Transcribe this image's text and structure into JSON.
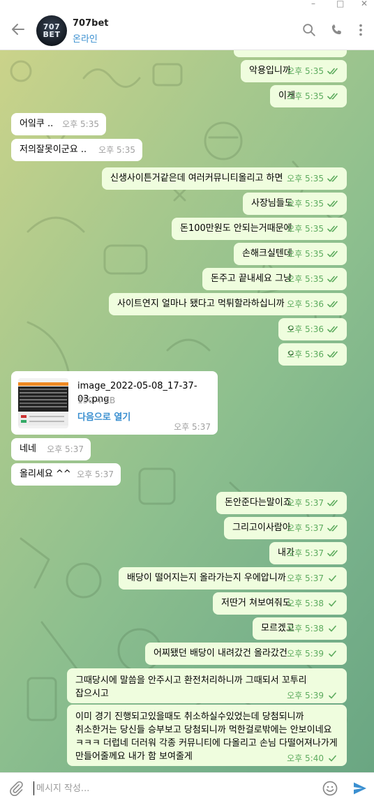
{
  "window": {
    "minimize": "–",
    "maximize": "□",
    "close": "✕"
  },
  "header": {
    "avatar_line1": "707",
    "avatar_line2": "BET",
    "name": "707bet",
    "status": "온라인"
  },
  "colors": {
    "accent": "#3a8fd0",
    "outgoing_bubble": "#effdde",
    "incoming_bubble": "#ffffff",
    "check": "#5dab5e"
  },
  "messages": [
    {
      "text": "",
      "time": "오후 5:35",
      "dir": "out",
      "read": true
    },
    {
      "text": "악용입니까",
      "time": "오후 5:35",
      "dir": "out",
      "read": true
    },
    {
      "text": "이게",
      "time": "오후 5:35",
      "dir": "out",
      "read": true
    },
    {
      "text": "어잌쿠 ..",
      "time": "오후 5:35",
      "dir": "in"
    },
    {
      "text": "저의잘못이군요 ..",
      "time": "오후 5:35",
      "dir": "in"
    },
    {
      "text": "신생사이튼거같은데 여러커뮤니티올리고 하면",
      "time": "오후 5:35",
      "dir": "out",
      "read": true
    },
    {
      "text": "사장님들도",
      "time": "오후 5:35",
      "dir": "out",
      "read": true
    },
    {
      "text": "돈100만원도 안되는거때문에",
      "time": "오후 5:35",
      "dir": "out",
      "read": true
    },
    {
      "text": "손해크실텐데",
      "time": "오후 5:35",
      "dir": "out",
      "read": true
    },
    {
      "text": "돈주고 끝내세요 그냥",
      "time": "오후 5:35",
      "dir": "out",
      "read": true
    },
    {
      "text": "사이트연지 얼마나 됐다고 먹튀할라하십니까",
      "time": "오후 5:36",
      "dir": "out",
      "read": true
    },
    {
      "text": "ㅇ",
      "time": "오후 5:36",
      "dir": "out",
      "read": true
    },
    {
      "text": "ㅇ",
      "time": "오후 5:36",
      "dir": "out",
      "read": true
    },
    {
      "type": "file",
      "file_name": "image_2022-05-08_17-37-03.png",
      "file_size": "150.4 KB",
      "open_label": "다음으로 열기",
      "time": "오후 5:37",
      "dir": "in"
    },
    {
      "text": "네네",
      "time": "오후 5:37",
      "dir": "in"
    },
    {
      "text": "올리세요 ^^",
      "time": "오후 5:37",
      "dir": "in"
    },
    {
      "text": "돈안준다는말이죠",
      "time": "오후 5:37",
      "dir": "out",
      "read": true
    },
    {
      "text": "그리고이사람아",
      "time": "오후 5:37",
      "dir": "out",
      "read": true
    },
    {
      "text": "내가",
      "time": "오후 5:37",
      "dir": "out",
      "read": true
    },
    {
      "text": "배당이 떨어지는지 올라가는지 우에압니까",
      "time": "오후 5:37",
      "dir": "out",
      "read": false
    },
    {
      "text": "저딴거 쳐보여줘도",
      "time": "오후 5:38",
      "dir": "out",
      "read": false
    },
    {
      "text": "모르겠고",
      "time": "오후 5:38",
      "dir": "out",
      "read": false
    },
    {
      "text": "어찌됐던 배당이 내려갔건 올라갔건",
      "time": "오후 5:39",
      "dir": "out",
      "read": false
    },
    {
      "text": "그때당시에 말씀을 안주시고 환전처리하니까 그때되서 꼬투리\n잡으시고",
      "time": "오후 5:39",
      "dir": "out",
      "read": false
    },
    {
      "text": "이미 경기 진행되고있을때도 취소하실수있었는데 당첨되니까\n취소한거는 당신들 승부보고 당첨되니까 먹한걸로밖에는 안보이네요\nㅋㅋㅋ 더럽네 더러워 각종 커뮤니티에 다올리고 손님 다떨어져나가게\n만들어줄께요 내가 함 보여줄게",
      "time": "오후 5:40",
      "dir": "out",
      "read": false
    }
  ],
  "input": {
    "placeholder": "메시지 작성..."
  }
}
